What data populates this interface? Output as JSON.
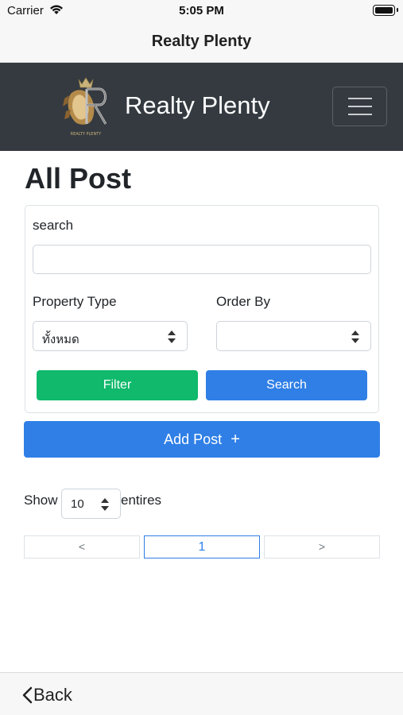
{
  "status_bar": {
    "carrier": "Carrier",
    "time": "5:05 PM"
  },
  "nav": {
    "title": "Realty Plenty"
  },
  "header": {
    "brand": "Realty Plenty",
    "logo_caption": "REALTY PLENTY",
    "background_color": "#343a40"
  },
  "page": {
    "title": "All Post"
  },
  "filter": {
    "search_label": "search",
    "search_value": "",
    "property_type_label": "Property Type",
    "property_type_value": "ทั้งหมด",
    "order_by_label": "Order By",
    "order_by_value": "",
    "filter_button": "Filter",
    "search_button": "Search"
  },
  "add_post": {
    "label": "Add Post",
    "icon": "+"
  },
  "entries": {
    "show_label": "Show",
    "value": "10",
    "entries_label": "entires"
  },
  "pagination": {
    "prev": "<",
    "current": "1",
    "next": ">"
  },
  "bottom_nav": {
    "back_label": "Back"
  },
  "colors": {
    "filter_green": "#10b96c",
    "primary_blue": "#2f7fe6",
    "dark_header": "#343a40"
  }
}
